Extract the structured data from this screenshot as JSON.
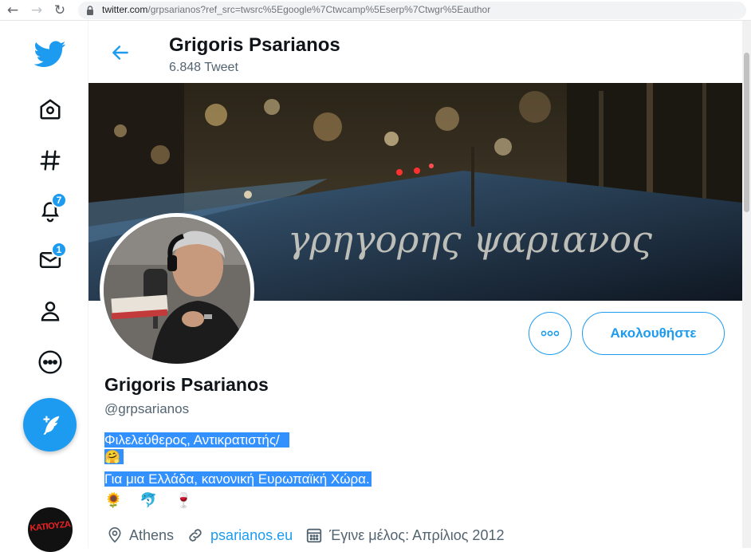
{
  "browser": {
    "url_host": "twitter.com",
    "url_rest": "/grpsarianos?ref_src=twsrc%5Egoogle%7Ctwcamp%5Eserp%7Ctwgr%5Eauthor"
  },
  "nav": {
    "items": [
      {
        "name": "twitter-logo-icon"
      },
      {
        "name": "home-icon"
      },
      {
        "name": "explore-hashtag-icon"
      },
      {
        "name": "notifications-bell-icon",
        "badge": "7"
      },
      {
        "name": "messages-envelope-icon",
        "badge": "1"
      },
      {
        "name": "profile-person-icon"
      },
      {
        "name": "more-circle-icon"
      }
    ],
    "account_label": "ΚΑΤΙΟΥΖΑ"
  },
  "header": {
    "name": "Grigoris Psarianos",
    "tweet_count": "6.848 Tweet"
  },
  "banner": {
    "script_text": "γρηγορης ψαριανος"
  },
  "profile": {
    "follow_label": "Ακολουθήστε",
    "name": "Grigoris Psarianos",
    "handle": "@grpsarianos",
    "bio_line1": "Φιλελεύθερος, Αντικρατιστής/",
    "bio_line3": "Για μια Ελλάδα, κανονική Ευρωπαϊκή Χώρα.",
    "location": "Athens",
    "website": "psarianos.eu",
    "joined": "Έγινε μέλος: Απρίλιος 2012"
  },
  "colors": {
    "accent": "#1d9bf0",
    "selection": "#3390ff",
    "secondary_text": "#536471"
  }
}
